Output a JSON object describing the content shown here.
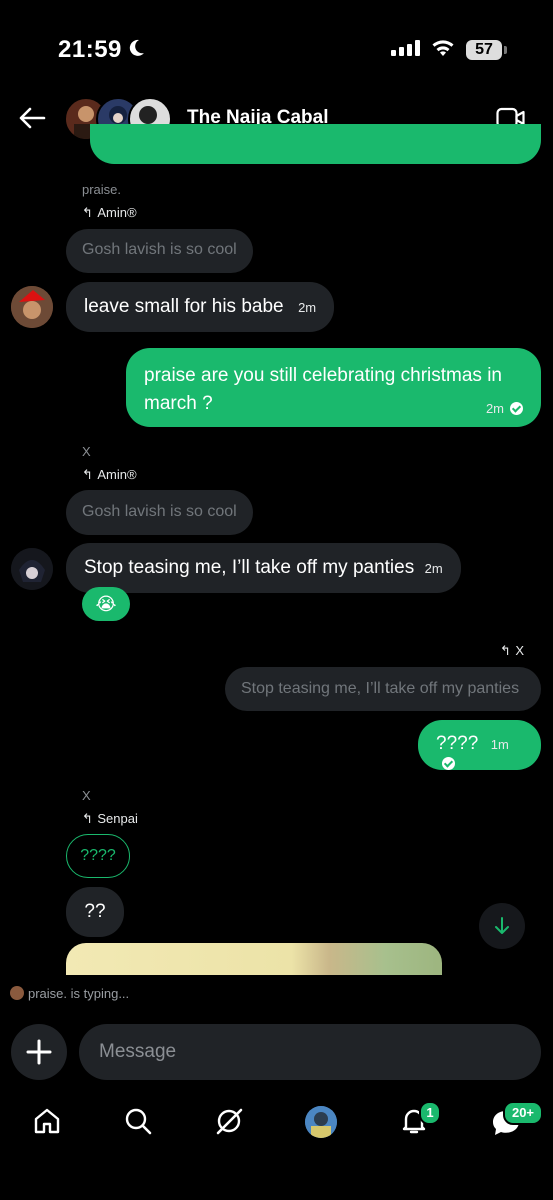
{
  "status_bar": {
    "time": "21:59",
    "battery": "57"
  },
  "header": {
    "title": "The Naija Cabal"
  },
  "messages": {
    "m1": {
      "sender": "praise.",
      "reply_to": "Amin®",
      "quote": "Gosh lavish is so cool",
      "text": "leave small for his babe",
      "time": "2m"
    },
    "m2": {
      "text": "praise are you still celebrating christmas in march ?",
      "line1": "praise are you still celebrating christmas in",
      "line2": "march ?",
      "time": "2m"
    },
    "m3": {
      "sender": "X",
      "reply_to": "Amin®",
      "quote": "Gosh lavish is so cool",
      "text": "Stop teasing me, I’ll take off my panties",
      "time": "2m",
      "reaction": "😭"
    },
    "m4": {
      "reply_to": "X",
      "quote": "Stop teasing me, I’ll take off my panties",
      "text": "????",
      "time": "1m"
    },
    "m5": {
      "sender": "X",
      "reply_to": "Senpai",
      "quote": "????",
      "text": "??"
    }
  },
  "typing": "praise. is typing...",
  "composer": {
    "placeholder": "Message"
  },
  "nav": {
    "notifications_badge": "1",
    "messages_badge": "20+"
  },
  "colors": {
    "accent": "#1ab96d",
    "bubble": "#202327",
    "background": "#000000"
  }
}
